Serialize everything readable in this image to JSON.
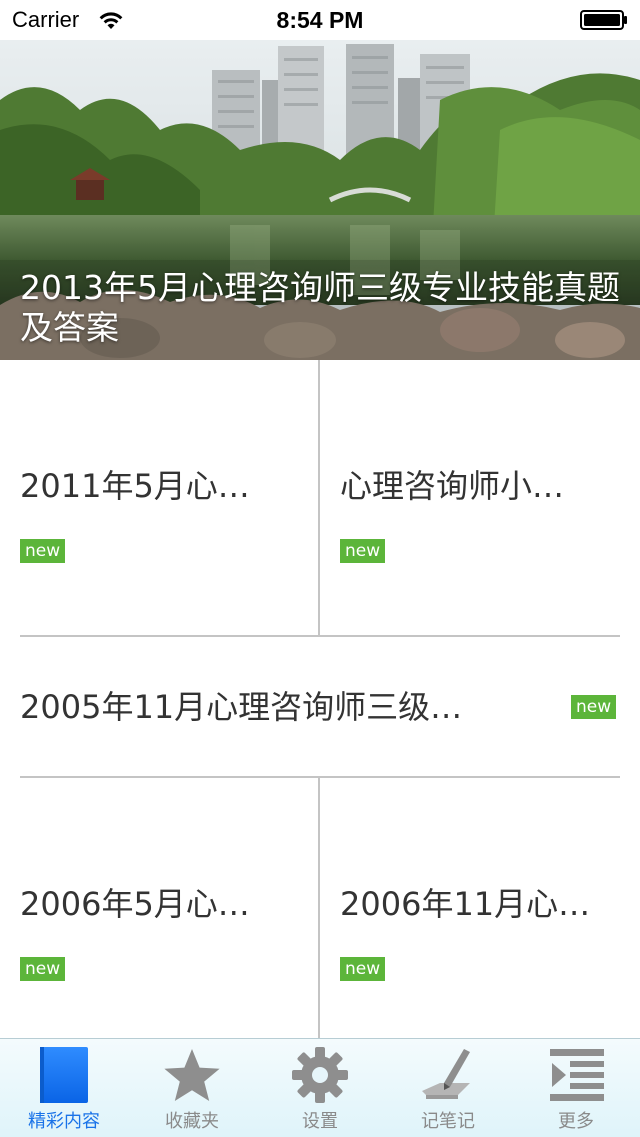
{
  "status_bar": {
    "carrier": "Carrier",
    "time": "8:54 PM",
    "wifi_icon": "wifi-icon",
    "battery_icon": "battery-icon"
  },
  "hero": {
    "title": "2013年5月心理咨询师三级专业技能真题及答案"
  },
  "articles": [
    {
      "title": "2011年5月心…",
      "badge": "new"
    },
    {
      "title": "心理咨询师小…",
      "badge": "new"
    },
    {
      "title": "2005年11月心理咨询师三级…",
      "badge": "new"
    },
    {
      "title": "2006年5月心…",
      "badge": "new"
    },
    {
      "title": "2006年11月心…",
      "badge": "new"
    }
  ],
  "tabs": [
    {
      "label": "精彩内容",
      "icon": "book-icon",
      "active": true
    },
    {
      "label": "收藏夹",
      "icon": "star-icon",
      "active": false
    },
    {
      "label": "设置",
      "icon": "gear-icon",
      "active": false
    },
    {
      "label": "记笔记",
      "icon": "pencil-icon",
      "active": false
    },
    {
      "label": "更多",
      "icon": "more-list-icon",
      "active": false
    }
  ],
  "colors": {
    "badge_green": "#5cb53a",
    "active_tab_blue": "#1a73e8",
    "inactive_tab_gray": "#8a8a8a",
    "divider_gray": "#c4c4c4"
  }
}
